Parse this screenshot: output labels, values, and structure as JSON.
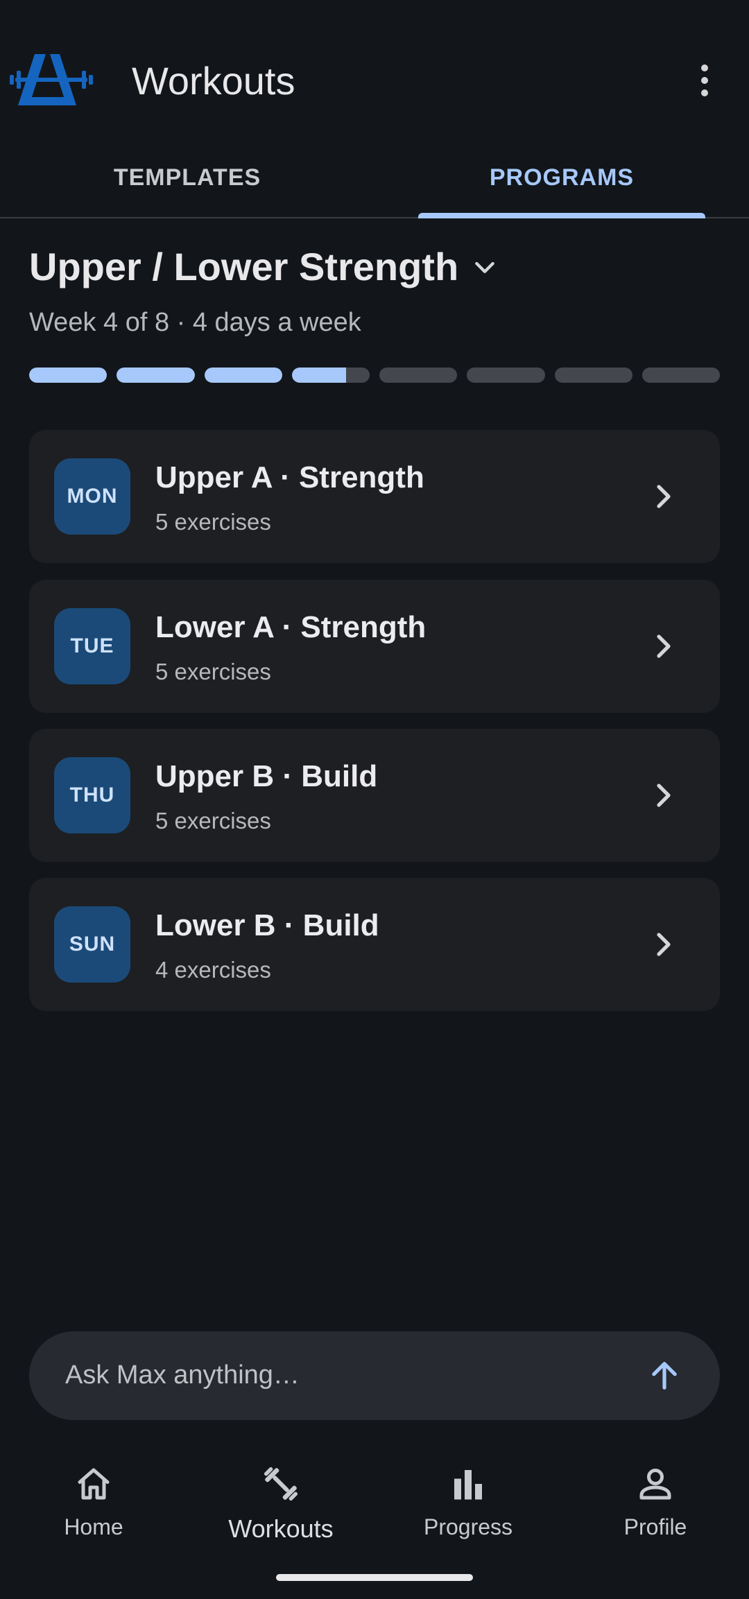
{
  "app": {
    "title": "Workouts",
    "accent_color": "#a7c8fa",
    "logo_color": "#1565c0"
  },
  "tabs": [
    {
      "label": "TEMPLATES",
      "selected": false
    },
    {
      "label": "PROGRAMS",
      "selected": true
    }
  ],
  "program": {
    "title": "Upper / Lower Strength",
    "subtitle": "Week 4 of 8 · 4 days a week",
    "total_weeks": 8,
    "current_week": 4,
    "current_week_progress": 0.7
  },
  "days": [
    {
      "day": "MON",
      "title": "Upper A · Strength",
      "subtitle": "5 exercises"
    },
    {
      "day": "TUE",
      "title": "Lower A · Strength",
      "subtitle": "5 exercises"
    },
    {
      "day": "THU",
      "title": "Upper B · Build",
      "subtitle": "5 exercises"
    },
    {
      "day": "SUN",
      "title": "Lower B · Build",
      "subtitle": "4 exercises"
    }
  ],
  "ask": {
    "placeholder": "Ask Max anything…",
    "send_icon": "arrow-up-icon"
  },
  "nav": [
    {
      "label": "Home",
      "icon": "home-icon",
      "active": false
    },
    {
      "label": "Workouts",
      "icon": "dumbbell-icon",
      "active": true
    },
    {
      "label": "Progress",
      "icon": "bar-chart-icon",
      "active": false
    },
    {
      "label": "Profile",
      "icon": "person-icon",
      "active": false
    }
  ]
}
